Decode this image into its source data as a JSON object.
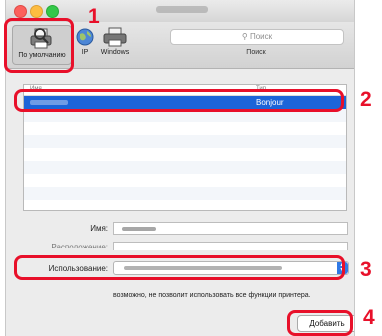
{
  "toolbar": {
    "default_label": "По умолчанию",
    "ip_label": "IP",
    "windows_label": "Windows",
    "search_placeholder": "Поиск",
    "search_caption": "Поиск"
  },
  "list": {
    "column_name": "Имя",
    "column_kind": "Тип",
    "selected_kind": "Bonjour"
  },
  "form": {
    "name_label": "Имя:",
    "location_label": "Расположение:",
    "use_label": "Использование:",
    "use_note": "возможно, не позволит использовать все функции принтера."
  },
  "actions": {
    "add_label": "Добавить"
  },
  "annotations": {
    "step1": "1",
    "step2": "2",
    "step3": "3",
    "step4": "4"
  },
  "colors": {
    "callout": "#e8102a",
    "selection": "#1c64d8",
    "select_arrow": "#2f79e6"
  }
}
